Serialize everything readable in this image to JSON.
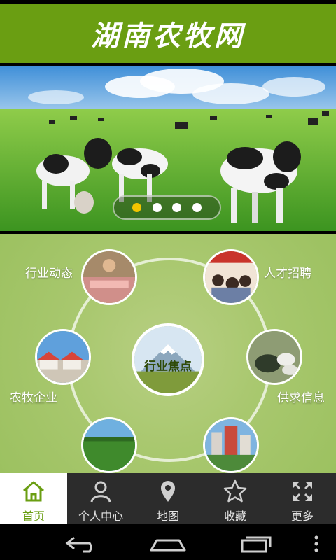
{
  "app": {
    "title": "湖南农牧网"
  },
  "banner": {
    "dots": 4,
    "active_index": 0
  },
  "menu": {
    "center": {
      "label": "行业焦点"
    },
    "items": [
      {
        "label": "行业动态"
      },
      {
        "label": "人才招聘"
      },
      {
        "label": "农牧企业"
      },
      {
        "label": "供求信息"
      }
    ]
  },
  "tabs": [
    {
      "label": "首页",
      "icon": "home-icon",
      "active": true
    },
    {
      "label": "个人中心",
      "icon": "person-icon",
      "active": false
    },
    {
      "label": "地图",
      "icon": "map-pin-icon",
      "active": false
    },
    {
      "label": "收藏",
      "icon": "star-icon",
      "active": false
    },
    {
      "label": "更多",
      "icon": "expand-icon",
      "active": false
    }
  ],
  "colors": {
    "brand": "#6a9e12",
    "tab_active_text": "#6a9e12",
    "dot_active": "#f2c500"
  }
}
